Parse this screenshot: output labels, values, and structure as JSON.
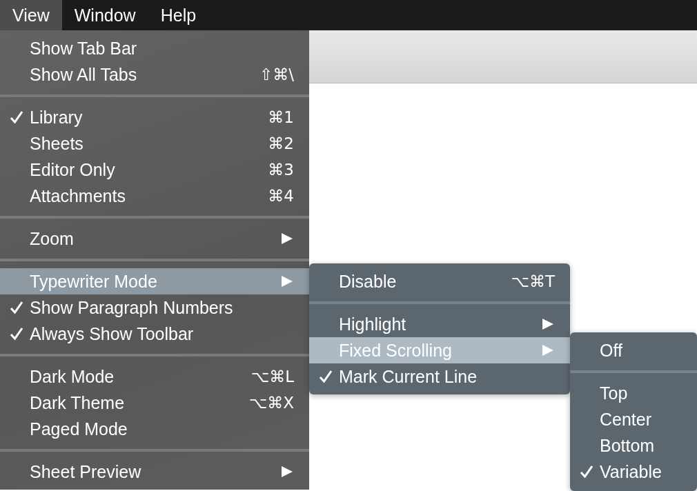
{
  "menubar": [
    {
      "label": "View",
      "selected": true
    },
    {
      "label": "Window",
      "selected": false
    },
    {
      "label": "Help",
      "selected": false
    }
  ],
  "menus": [
    {
      "kind": "main",
      "sections": [
        [
          {
            "label": "Show Tab Bar",
            "checked": false,
            "has_submenu": false,
            "selected": false
          },
          {
            "label": "Show All Tabs",
            "shortcut": "⇧⌘\\",
            "checked": false,
            "has_submenu": false,
            "selected": false
          }
        ],
        [
          {
            "label": "Library",
            "shortcut": "⌘1",
            "checked": true,
            "has_submenu": false,
            "selected": false
          },
          {
            "label": "Sheets",
            "shortcut": "⌘2",
            "checked": false,
            "has_submenu": false,
            "selected": false
          },
          {
            "label": "Editor Only",
            "shortcut": "⌘3",
            "checked": false,
            "has_submenu": false,
            "selected": false
          },
          {
            "label": "Attachments",
            "shortcut": "⌘4",
            "checked": false,
            "has_submenu": false,
            "selected": false
          }
        ],
        [
          {
            "label": "Zoom",
            "checked": false,
            "has_submenu": true,
            "selected": false
          }
        ],
        [
          {
            "label": "Typewriter Mode",
            "checked": false,
            "has_submenu": true,
            "selected": true
          },
          {
            "label": "Show Paragraph Numbers",
            "checked": true,
            "has_submenu": false,
            "selected": false
          },
          {
            "label": "Always Show Toolbar",
            "checked": true,
            "has_submenu": false,
            "selected": false
          }
        ],
        [
          {
            "label": "Dark Mode",
            "shortcut": "⌥⌘L",
            "checked": false,
            "has_submenu": false,
            "selected": false
          },
          {
            "label": "Dark Theme",
            "shortcut": "⌥⌘X",
            "checked": false,
            "has_submenu": false,
            "selected": false
          },
          {
            "label": "Paged Mode",
            "checked": false,
            "has_submenu": false,
            "selected": false
          }
        ],
        [
          {
            "label": "Sheet Preview",
            "checked": false,
            "has_submenu": true,
            "selected": false
          }
        ]
      ]
    },
    {
      "kind": "submenu",
      "sections": [
        [
          {
            "label": "Disable",
            "shortcut": "⌥⌘T",
            "checked": false,
            "has_submenu": false,
            "selected": false
          }
        ],
        [
          {
            "label": "Highlight",
            "checked": false,
            "has_submenu": true,
            "selected": false
          },
          {
            "label": "Fixed Scrolling",
            "checked": false,
            "has_submenu": true,
            "selected": true
          },
          {
            "label": "Mark Current Line",
            "checked": true,
            "has_submenu": false,
            "selected": false
          }
        ]
      ]
    },
    {
      "kind": "submenu2",
      "sections": [
        [
          {
            "label": "Off",
            "checked": false,
            "has_submenu": false,
            "selected": false
          }
        ],
        [
          {
            "label": "Top",
            "checked": false,
            "has_submenu": false,
            "selected": false
          },
          {
            "label": "Center",
            "checked": false,
            "has_submenu": false,
            "selected": false
          },
          {
            "label": "Bottom",
            "checked": false,
            "has_submenu": false,
            "selected": false
          },
          {
            "label": "Variable",
            "checked": true,
            "has_submenu": false,
            "selected": false
          }
        ]
      ]
    }
  ]
}
